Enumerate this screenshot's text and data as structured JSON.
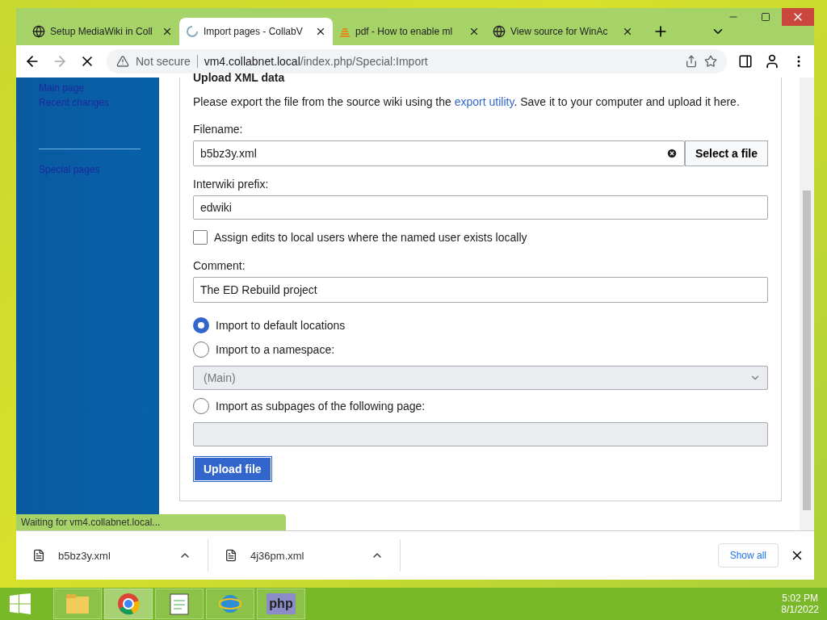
{
  "tabs": [
    {
      "title": "Setup MediaWiki in Coll",
      "kind": "globe",
      "selected": false
    },
    {
      "title": "Import pages - CollabV",
      "kind": "loading",
      "selected": true
    },
    {
      "title": "pdf - How to enable ml",
      "kind": "stack",
      "selected": false
    },
    {
      "title": "View source for WinAc",
      "kind": "globe",
      "selected": false
    }
  ],
  "address": {
    "security": "Not secure",
    "host": "vm4.collabnet.local",
    "path": "/index.php/Special:Import"
  },
  "sidebar": {
    "items": [
      {
        "label": "Main page"
      },
      {
        "label": "Recent changes"
      }
    ],
    "tools_items": [
      {
        "label": "Special pages"
      }
    ]
  },
  "form": {
    "heading": "Upload XML data",
    "intro_before": "Please export the file from the source wiki using the ",
    "intro_link": "export utility",
    "intro_after": ". Save it to your computer and upload it here.",
    "filename_label": "Filename:",
    "filename_value": "b5bz3y.xml",
    "select_button": "Select a file",
    "interwiki_label": "Interwiki prefix:",
    "interwiki_value": "edwiki",
    "assign_label": "Assign edits to local users where the named user exists locally",
    "assign_checked": false,
    "comment_label": "Comment:",
    "comment_value": "The ED Rebuild project",
    "options": [
      {
        "label": "Import to default locations",
        "selected": true,
        "kind": "plain"
      },
      {
        "label": "Import to a namespace:",
        "selected": false,
        "kind": "select",
        "value": "(Main)",
        "disabled": true
      },
      {
        "label": "Import as subpages of the following page:",
        "selected": false,
        "kind": "text",
        "disabled": true
      }
    ],
    "submit": "Upload file"
  },
  "status": "Waiting for vm4.collabnet.local...",
  "downloads": [
    {
      "name": "b5bz3y.xml"
    },
    {
      "name": "4j36pm.xml"
    }
  ],
  "show_all": "Show all",
  "clock": {
    "time": "5:02 PM",
    "date": "8/1/2022"
  },
  "taskbar": [
    {
      "kind": "folder",
      "selected": false
    },
    {
      "kind": "browser",
      "selected": true
    },
    {
      "kind": "notepad",
      "selected": false
    },
    {
      "kind": "globe",
      "selected": false
    },
    {
      "kind": "label",
      "label": "php",
      "selected": false
    }
  ]
}
